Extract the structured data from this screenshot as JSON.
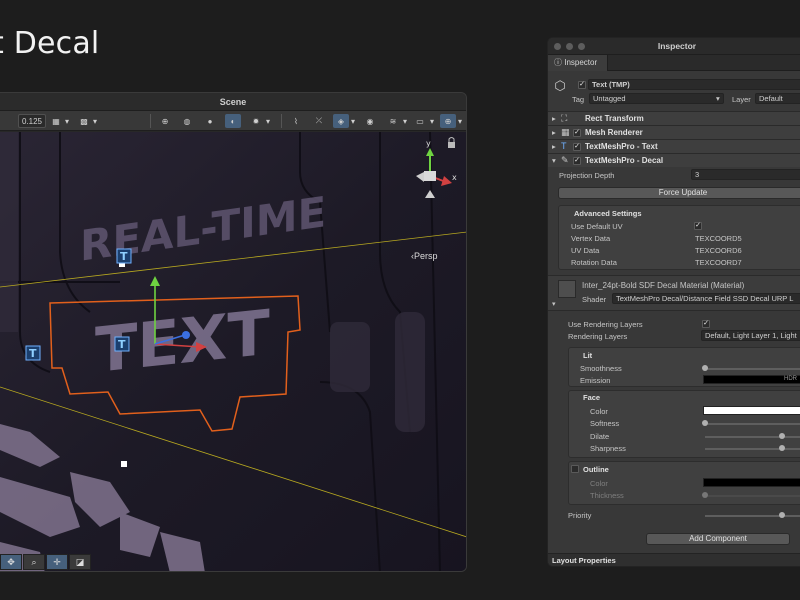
{
  "page": {
    "title": "t Decal"
  },
  "scene": {
    "title": "Scene",
    "toolbar": {
      "grid_value": "0.125"
    },
    "persp_label": "‹Persp",
    "gizmo_axes": {
      "y": "y",
      "x": "x"
    },
    "viewport_text": {
      "line1": "REAL-TIME",
      "line2": "TEXT"
    }
  },
  "inspector": {
    "title": "Inspector",
    "tab": "Inspector",
    "object": {
      "name": "Text (TMP)",
      "tag_label": "Tag",
      "tag_value": "Untagged",
      "layer_label": "Layer",
      "layer_value": "Default"
    },
    "components": [
      {
        "label": "Rect Transform"
      },
      {
        "label": "Mesh Renderer"
      },
      {
        "label": "TextMeshPro - Text"
      },
      {
        "label": "TextMeshPro - Decal"
      }
    ],
    "decal": {
      "projection_depth_label": "Projection Depth",
      "projection_depth_value": "3",
      "force_update_label": "Force Update",
      "advanced_title": "Advanced Settings",
      "use_default_uv_label": "Use Default UV",
      "vertex_data_label": "Vertex Data",
      "vertex_data_value": "TEXCOORD5",
      "uv_data_label": "UV Data",
      "uv_data_value": "TEXCOORD6",
      "rotation_data_label": "Rotation Data",
      "rotation_data_value": "TEXCOORD7"
    },
    "material": {
      "name": "Inter_24pt-Bold SDF Decal Material (Material)",
      "shader_label": "Shader",
      "shader_value": "TextMeshPro Decal/Distance Field SSD Decal URP L"
    },
    "rendering": {
      "use_layers_label": "Use Rendering Layers",
      "layers_label": "Rendering Layers",
      "layers_value": "Default, Light Layer 1, Light"
    },
    "lit": {
      "title": "Lit",
      "smoothness_label": "Smoothness",
      "smoothness_value": 0.0,
      "emission_label": "Emission",
      "emission_hdr": "HDR"
    },
    "face": {
      "title": "Face",
      "color_label": "Color",
      "softness_label": "Softness",
      "softness_value": 0.0,
      "dilate_label": "Dilate",
      "dilate_value": 0.75,
      "sharpness_label": "Sharpness",
      "sharpness_value": 0.75
    },
    "outline": {
      "title": "Outline",
      "color_label": "Color",
      "thickness_label": "Thickness",
      "thickness_value": 0.0
    },
    "priority_label": "Priority",
    "priority_value": 0.75,
    "add_component_label": "Add Component",
    "layout_properties_label": "Layout Properties"
  },
  "colors": {
    "accent_blue": "#46607c",
    "decal_outline": "#e2601c",
    "gizmo_y": "#6fd341",
    "gizmo_x": "#d14141",
    "gizmo_z": "#3b6fe0"
  }
}
